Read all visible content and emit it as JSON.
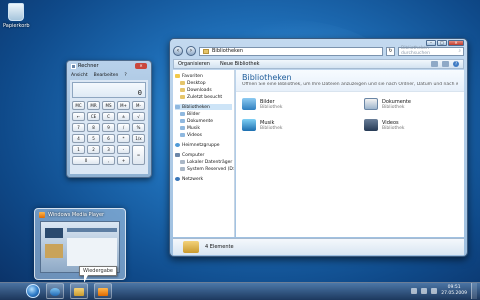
{
  "desktop": {
    "recycle_bin_label": "Papierkorb"
  },
  "calculator": {
    "title": "Rechner",
    "menu": [
      "Ansicht",
      "Bearbeiten",
      "?"
    ],
    "display": "0",
    "keys": [
      "MC",
      "MR",
      "MS",
      "M+",
      "M-",
      "←",
      "CE",
      "C",
      "±",
      "√",
      "7",
      "8",
      "9",
      "/",
      "%",
      "4",
      "5",
      "6",
      "*",
      "1/x",
      "1",
      "2",
      "3",
      "-",
      "=",
      "0",
      ",",
      "+"
    ]
  },
  "explorer": {
    "address": "Bibliotheken",
    "search_placeholder": "Bibliotheken durchsuchen",
    "toolbar": {
      "organize": "Organisieren",
      "new_library": "Neue Bibliothek"
    },
    "nav": {
      "favorites": "Favoriten",
      "desktop": "Desktop",
      "downloads": "Downloads",
      "recent": "Zuletzt besucht",
      "libraries": "Bibliotheken",
      "pictures": "Bilder",
      "documents": "Dokumente",
      "music": "Musik",
      "videos": "Videos",
      "homegroup": "Heimnetzgruppe",
      "computer": "Computer",
      "local_disk": "Lokaler Datenträger",
      "system_reserved": "System Reserved (D:",
      "network": "Netzwerk"
    },
    "content": {
      "title": "Bibliotheken",
      "description": "Öffnen Sie eine Bibliothek, um Ihre Dateien anzuzeigen und sie nach Ordner, Datum und nach weiteren Eige...",
      "items": [
        {
          "name": "Bilder",
          "type": "Bibliothek"
        },
        {
          "name": "Dokumente",
          "type": "Bibliothek"
        },
        {
          "name": "Musik",
          "type": "Bibliothek"
        },
        {
          "name": "Videos",
          "type": "Bibliothek"
        }
      ]
    },
    "status": "4 Elemente"
  },
  "media_player_thumbnail": {
    "title": "Windows Media Player",
    "tooltip": "Wiedergabe"
  },
  "taskbar": {
    "time": "09:51",
    "date": "27.05.2009"
  }
}
